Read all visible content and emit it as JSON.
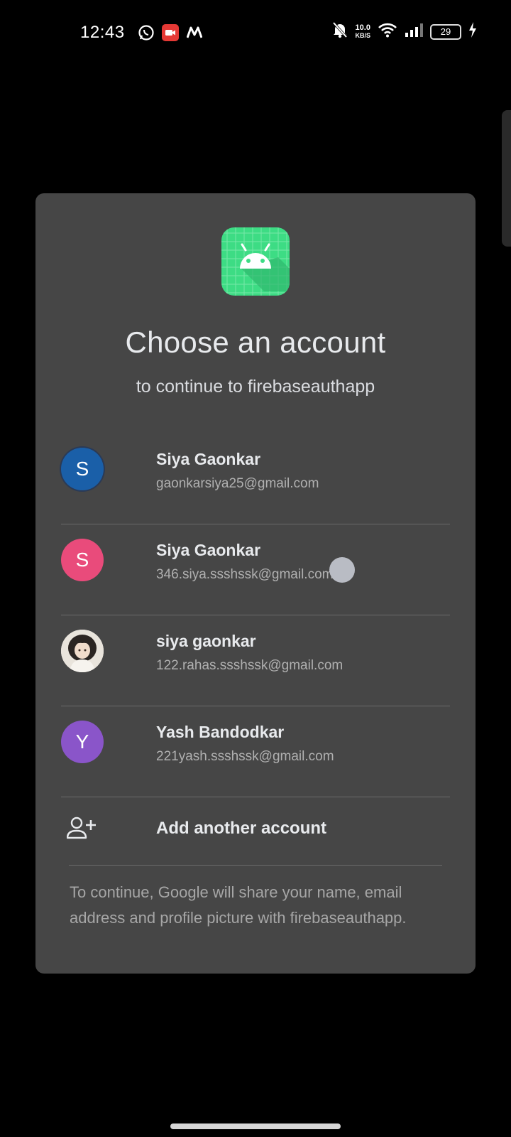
{
  "status_bar": {
    "time": "12:43",
    "net_speed_value": "10.0",
    "net_speed_unit": "KB/S",
    "battery": "29"
  },
  "dialog": {
    "title": "Choose an account",
    "subtitle": "to continue to firebaseauthapp",
    "accounts": [
      {
        "name": "Siya Gaonkar",
        "email": "gaonkarsiya25@gmail.com",
        "initial": "S",
        "avatar_color": "#1a5fa8"
      },
      {
        "name": "Siya Gaonkar",
        "email": "346.siya.ssshssk@gmail.com",
        "initial": "S",
        "avatar_color": "#e94b7b"
      },
      {
        "name": "siya gaonkar",
        "email": "122.rahas.ssshssk@gmail.com",
        "initial": "",
        "avatar_color": "#e9e4dc"
      },
      {
        "name": "Yash Bandodkar",
        "email": "221yash.ssshssk@gmail.com",
        "initial": "Y",
        "avatar_color": "#8a55c9"
      }
    ],
    "add_account_label": "Add another account",
    "footer": "To continue, Google will share your name, email address and profile picture with firebaseauthapp."
  },
  "colors": {
    "background": "#000000",
    "dialog": "#464646",
    "app_icon": "#3ddc84"
  }
}
